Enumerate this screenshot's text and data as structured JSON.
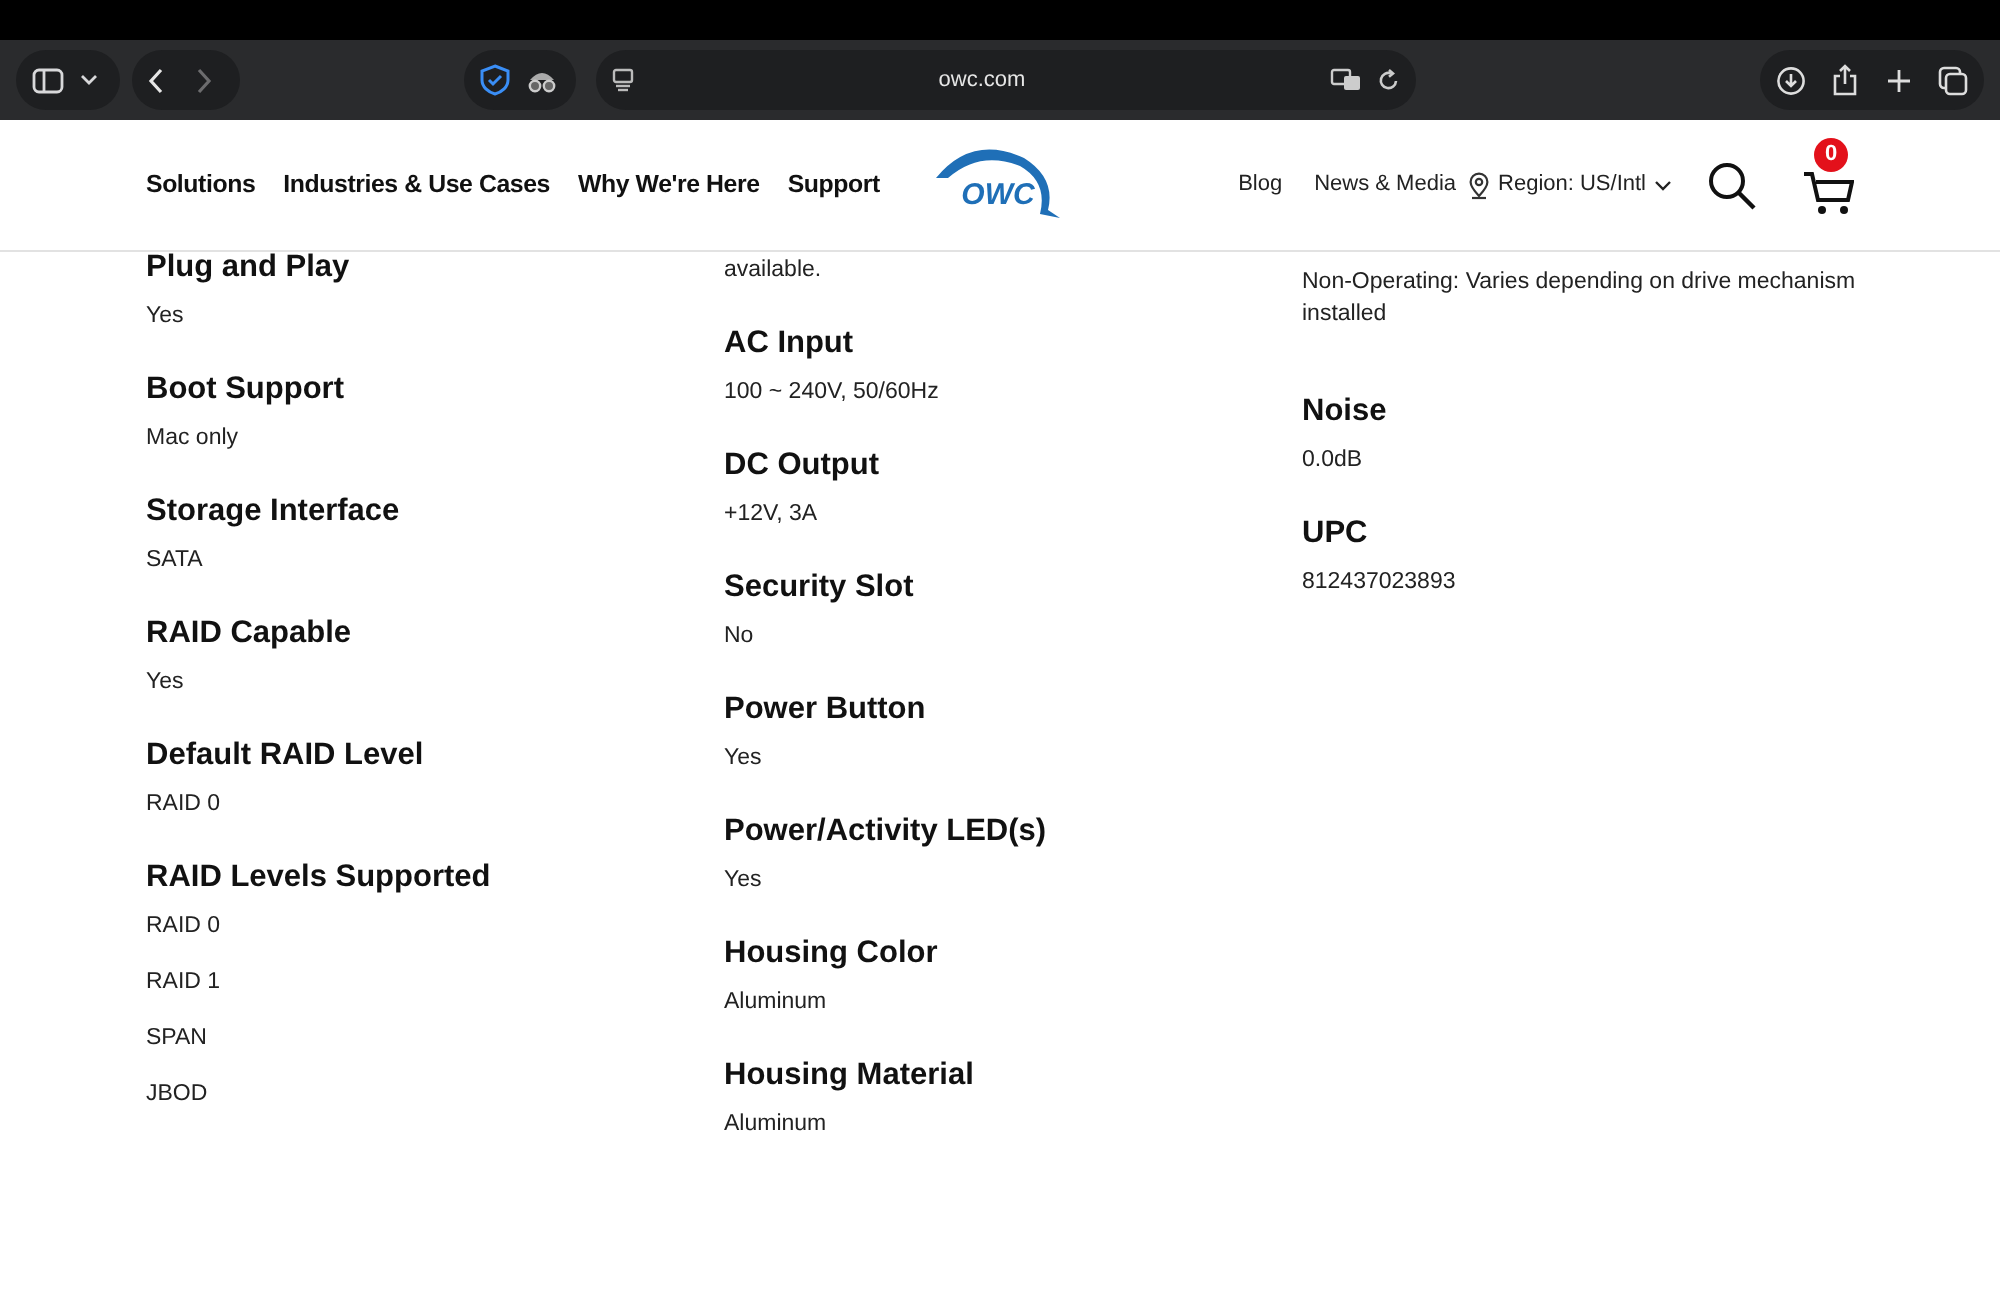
{
  "browser": {
    "url": "owc.com"
  },
  "nav": {
    "left_links": [
      "Solutions",
      "Industries & Use Cases",
      "Why We're Here",
      "Support"
    ],
    "logo_text": "OWC",
    "right_links": [
      "Blog",
      "News & Media"
    ],
    "region": "Region: US/Intl",
    "cart_count": "0"
  },
  "spec_columns": [
    [
      {
        "heading": "Plug and Play",
        "values": [
          "Yes"
        ]
      },
      {
        "heading": "Boot Support",
        "values": [
          "Mac only"
        ]
      },
      {
        "heading": "Storage Interface",
        "values": [
          "SATA"
        ]
      },
      {
        "heading": "RAID Capable",
        "values": [
          "Yes"
        ]
      },
      {
        "heading": "Default RAID Level",
        "values": [
          "RAID 0"
        ]
      },
      {
        "heading": "RAID Levels Supported",
        "values": [
          "RAID 0",
          "RAID 1",
          "SPAN",
          "JBOD"
        ]
      }
    ],
    [
      {
        "values": [
          "available."
        ]
      },
      {
        "heading": "AC Input",
        "values": [
          "100 ~ 240V, 50/60Hz"
        ]
      },
      {
        "heading": "DC Output",
        "values": [
          "+12V, 3A"
        ]
      },
      {
        "heading": "Security Slot",
        "values": [
          "No"
        ]
      },
      {
        "heading": "Power Button",
        "values": [
          "Yes"
        ]
      },
      {
        "heading": "Power/Activity LED(s)",
        "values": [
          "Yes"
        ]
      },
      {
        "heading": "Housing Color",
        "values": [
          "Aluminum"
        ]
      },
      {
        "heading": "Housing Material",
        "values": [
          "Aluminum"
        ]
      }
    ],
    [
      {
        "values": [
          "Non-Operating: Varies depending on drive mechanism installed"
        ]
      },
      {
        "heading": "Noise",
        "values": [
          "0.0dB"
        ]
      },
      {
        "heading": "UPC",
        "values": [
          "812437023893"
        ]
      }
    ]
  ]
}
